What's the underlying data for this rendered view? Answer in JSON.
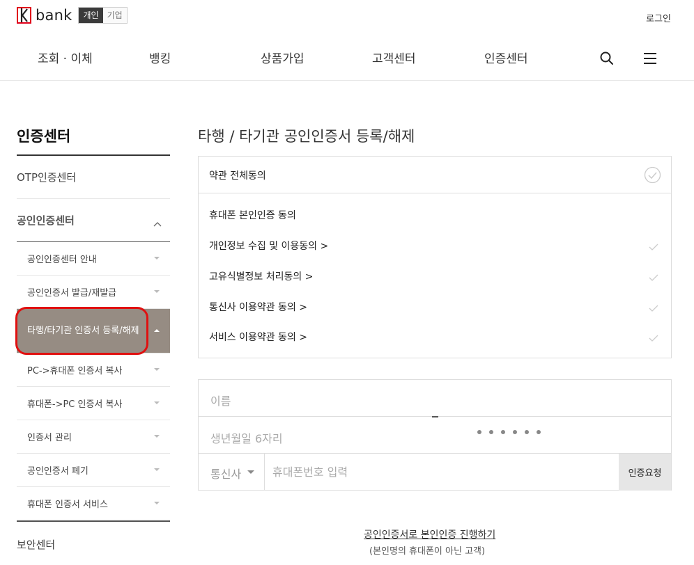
{
  "header": {
    "logo_text": "bank",
    "mode_personal": "개인",
    "mode_business": "기업",
    "login": "로그인",
    "nav": [
      "조회 · 이체",
      "뱅킹",
      "상품가입",
      "고객센터",
      "인증센터"
    ]
  },
  "sidebar": {
    "title": "인증센터",
    "otp": "OTP인증센터",
    "cert_center": "공인인증센터",
    "sub_items": [
      "공인인증센터 안내",
      "공인인증서 발급/재발급",
      "타행/타기관 인증서 등록/해제",
      "PC->휴대폰 인증서 복사",
      "휴대폰->PC 인증서 복사",
      "인증서 관리",
      "공인인증서 폐기",
      "휴대폰 인증서 서비스"
    ],
    "security": "보안센터"
  },
  "main": {
    "title": "타행 / 타기관 공인인증서 등록/해제",
    "agree_all": "약관 전체동의",
    "phone_consent": "휴대폰 본인인증 동의",
    "terms": [
      "개인정보 수집 및 이용동의 >",
      "고유식별정보 처리동의 >",
      "통신사 이용약관 동의 >",
      "서비스 이용약관 동의 >"
    ],
    "name_placeholder": "이름",
    "birth_placeholder": "생년월일 6자리",
    "carrier": "통신사",
    "phone_placeholder": "휴대폰번호 입력",
    "request_button": "인증요청",
    "cert_link": "공인인증서로 본인인증 진행하기",
    "cert_note": "(본인명의 휴대폰이 아닌 고객)"
  },
  "colors": {
    "active_menu_bg": "#968c83",
    "logo_red": "#e0001b",
    "highlight_ring": "#e01010"
  }
}
